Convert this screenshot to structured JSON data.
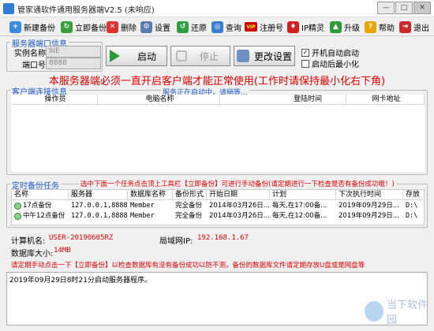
{
  "window": {
    "title": "管家通软件通用服务器端V2.5 (未响应)",
    "min": "—",
    "max": "□",
    "close": "✕"
  },
  "toolbar": [
    {
      "label": "新建备份",
      "icon": "new-backup-icon",
      "color": "#3b8be0"
    },
    {
      "label": "立即备份",
      "icon": "backup-now-icon",
      "color": "#3a9f3a"
    },
    {
      "label": "删除",
      "icon": "delete-icon",
      "color": "#d33"
    },
    {
      "label": "设置",
      "icon": "settings-icon",
      "color": "#5a7db0"
    },
    {
      "label": "还原",
      "icon": "restore-icon",
      "color": "#2f9e3f"
    },
    {
      "label": "查询",
      "icon": "query-icon",
      "color": "#3a7fcf"
    },
    {
      "label": "注册号",
      "icon": "vip-icon",
      "color": "#c00"
    },
    {
      "label": "IP精灵",
      "icon": "ip-wizard-icon",
      "color": "#d02020"
    },
    {
      "label": "升级",
      "icon": "upgrade-icon",
      "color": "#2e9a3c"
    },
    {
      "label": "帮助",
      "icon": "help-icon",
      "color": "#e8a400"
    },
    {
      "label": "退出",
      "icon": "exit-icon",
      "color": "#cc2a2a"
    }
  ],
  "port_group": {
    "caption": "服务器端口信息",
    "instance_label": "实例名称:",
    "instance_value": "IIIE",
    "port_label": "端口号:",
    "port_value": "8888"
  },
  "buttons": {
    "start": "启动",
    "stop": "停止",
    "change": "更改设置"
  },
  "options": {
    "autostart": "开机自动启动",
    "minimize": "启动后最小化"
  },
  "notice": "本服务器端必须一直开启客户端才能正常使用(工作时请保持最小化右下角)",
  "client_group": {
    "caption": "客户端连接信息",
    "status": "服务正在启动中，请稍等...",
    "columns": [
      "操作员",
      "电脑名称",
      "登陆时间",
      "网卡地址"
    ]
  },
  "tasks_group": {
    "caption": "定时备份任务",
    "hint": "选中下面一个任务点击顶上工具栏【立即备份】可进行手动备份(请定期进行一下检查是否有备份成功哦！)",
    "columns": [
      "名称",
      "服务器",
      "数据库名称",
      "备份形式",
      "开始日期",
      "计划",
      "下次执行时间",
      "存放"
    ],
    "rows": [
      [
        "17点备份",
        "127.0.0.1,8888",
        "Member",
        "完全备份",
        "2014年03月26日...",
        "每天,在17:00备...",
        "2019年09月29日...",
        "D:\\"
      ],
      [
        "中午12点备份",
        "127.0.0.1,8888",
        "Member",
        "完全备份",
        "2014年03月26日...",
        "每天,在12:00备...",
        "2019年09月29日...",
        "D:\\"
      ]
    ]
  },
  "info": {
    "computer_label": "计算机名:",
    "computer_value": "USER-20190605RZ",
    "lan_label": "局域网IP:",
    "lan_value": "192.168.1.67",
    "db_label": "数据库大小:",
    "db_value": "14MB"
  },
  "warning": "请定期手动点击一下【立即备份】以检查数据库有没有备份成功以防不测，备份的数据库文件请定期存放U盘或是网盘等",
  "log": "2019年09月29日8时21分启动服务器程序。",
  "watermark": "当下软件园"
}
